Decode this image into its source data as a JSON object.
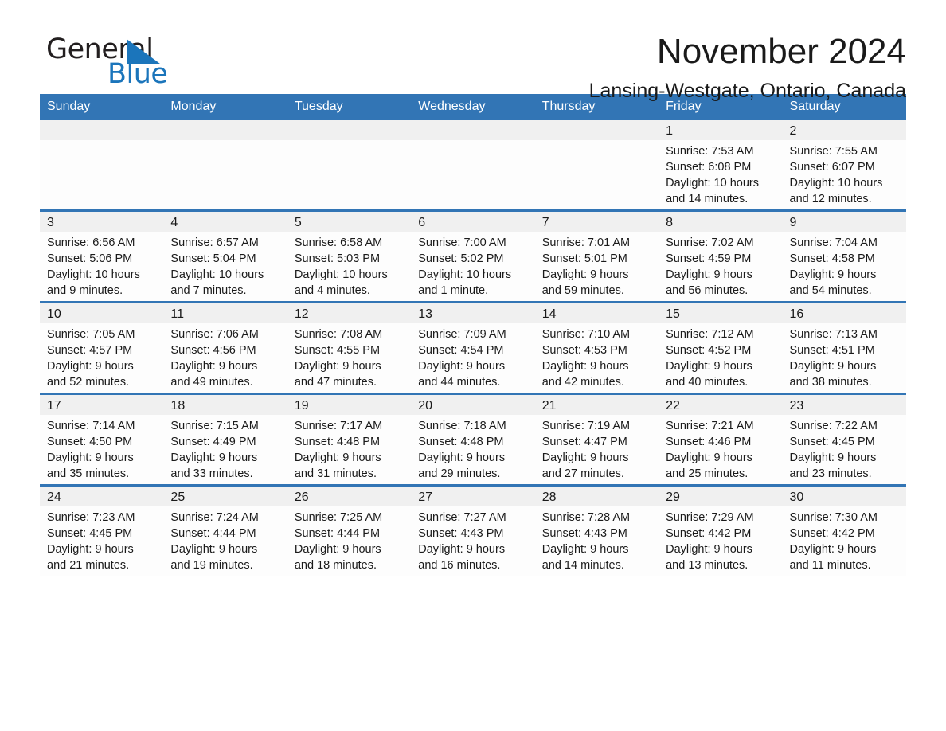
{
  "logo": {
    "word_1": "General",
    "word_2": "Blue",
    "triangle_color": "#1b75bb"
  },
  "header": {
    "title": "November 2024",
    "location": "Lansing-Westgate, Ontario, Canada",
    "accent_color": "#3275b5",
    "band_color": "#f0f0f0"
  },
  "weekday_headers": [
    "Sunday",
    "Monday",
    "Tuesday",
    "Wednesday",
    "Thursday",
    "Friday",
    "Saturday"
  ],
  "weeks": [
    [
      {
        "day": "",
        "empty": true
      },
      {
        "day": "",
        "empty": true
      },
      {
        "day": "",
        "empty": true
      },
      {
        "day": "",
        "empty": true
      },
      {
        "day": "",
        "empty": true
      },
      {
        "day": "1",
        "sunrise": "Sunrise: 7:53 AM",
        "sunset": "Sunset: 6:08 PM",
        "daylight_1": "Daylight: 10 hours",
        "daylight_2": "and 14 minutes."
      },
      {
        "day": "2",
        "sunrise": "Sunrise: 7:55 AM",
        "sunset": "Sunset: 6:07 PM",
        "daylight_1": "Daylight: 10 hours",
        "daylight_2": "and 12 minutes."
      }
    ],
    [
      {
        "day": "3",
        "sunrise": "Sunrise: 6:56 AM",
        "sunset": "Sunset: 5:06 PM",
        "daylight_1": "Daylight: 10 hours",
        "daylight_2": "and 9 minutes."
      },
      {
        "day": "4",
        "sunrise": "Sunrise: 6:57 AM",
        "sunset": "Sunset: 5:04 PM",
        "daylight_1": "Daylight: 10 hours",
        "daylight_2": "and 7 minutes."
      },
      {
        "day": "5",
        "sunrise": "Sunrise: 6:58 AM",
        "sunset": "Sunset: 5:03 PM",
        "daylight_1": "Daylight: 10 hours",
        "daylight_2": "and 4 minutes."
      },
      {
        "day": "6",
        "sunrise": "Sunrise: 7:00 AM",
        "sunset": "Sunset: 5:02 PM",
        "daylight_1": "Daylight: 10 hours",
        "daylight_2": "and 1 minute."
      },
      {
        "day": "7",
        "sunrise": "Sunrise: 7:01 AM",
        "sunset": "Sunset: 5:01 PM",
        "daylight_1": "Daylight: 9 hours",
        "daylight_2": "and 59 minutes."
      },
      {
        "day": "8",
        "sunrise": "Sunrise: 7:02 AM",
        "sunset": "Sunset: 4:59 PM",
        "daylight_1": "Daylight: 9 hours",
        "daylight_2": "and 56 minutes."
      },
      {
        "day": "9",
        "sunrise": "Sunrise: 7:04 AM",
        "sunset": "Sunset: 4:58 PM",
        "daylight_1": "Daylight: 9 hours",
        "daylight_2": "and 54 minutes."
      }
    ],
    [
      {
        "day": "10",
        "sunrise": "Sunrise: 7:05 AM",
        "sunset": "Sunset: 4:57 PM",
        "daylight_1": "Daylight: 9 hours",
        "daylight_2": "and 52 minutes."
      },
      {
        "day": "11",
        "sunrise": "Sunrise: 7:06 AM",
        "sunset": "Sunset: 4:56 PM",
        "daylight_1": "Daylight: 9 hours",
        "daylight_2": "and 49 minutes."
      },
      {
        "day": "12",
        "sunrise": "Sunrise: 7:08 AM",
        "sunset": "Sunset: 4:55 PM",
        "daylight_1": "Daylight: 9 hours",
        "daylight_2": "and 47 minutes."
      },
      {
        "day": "13",
        "sunrise": "Sunrise: 7:09 AM",
        "sunset": "Sunset: 4:54 PM",
        "daylight_1": "Daylight: 9 hours",
        "daylight_2": "and 44 minutes."
      },
      {
        "day": "14",
        "sunrise": "Sunrise: 7:10 AM",
        "sunset": "Sunset: 4:53 PM",
        "daylight_1": "Daylight: 9 hours",
        "daylight_2": "and 42 minutes."
      },
      {
        "day": "15",
        "sunrise": "Sunrise: 7:12 AM",
        "sunset": "Sunset: 4:52 PM",
        "daylight_1": "Daylight: 9 hours",
        "daylight_2": "and 40 minutes."
      },
      {
        "day": "16",
        "sunrise": "Sunrise: 7:13 AM",
        "sunset": "Sunset: 4:51 PM",
        "daylight_1": "Daylight: 9 hours",
        "daylight_2": "and 38 minutes."
      }
    ],
    [
      {
        "day": "17",
        "sunrise": "Sunrise: 7:14 AM",
        "sunset": "Sunset: 4:50 PM",
        "daylight_1": "Daylight: 9 hours",
        "daylight_2": "and 35 minutes."
      },
      {
        "day": "18",
        "sunrise": "Sunrise: 7:15 AM",
        "sunset": "Sunset: 4:49 PM",
        "daylight_1": "Daylight: 9 hours",
        "daylight_2": "and 33 minutes."
      },
      {
        "day": "19",
        "sunrise": "Sunrise: 7:17 AM",
        "sunset": "Sunset: 4:48 PM",
        "daylight_1": "Daylight: 9 hours",
        "daylight_2": "and 31 minutes."
      },
      {
        "day": "20",
        "sunrise": "Sunrise: 7:18 AM",
        "sunset": "Sunset: 4:48 PM",
        "daylight_1": "Daylight: 9 hours",
        "daylight_2": "and 29 minutes."
      },
      {
        "day": "21",
        "sunrise": "Sunrise: 7:19 AM",
        "sunset": "Sunset: 4:47 PM",
        "daylight_1": "Daylight: 9 hours",
        "daylight_2": "and 27 minutes."
      },
      {
        "day": "22",
        "sunrise": "Sunrise: 7:21 AM",
        "sunset": "Sunset: 4:46 PM",
        "daylight_1": "Daylight: 9 hours",
        "daylight_2": "and 25 minutes."
      },
      {
        "day": "23",
        "sunrise": "Sunrise: 7:22 AM",
        "sunset": "Sunset: 4:45 PM",
        "daylight_1": "Daylight: 9 hours",
        "daylight_2": "and 23 minutes."
      }
    ],
    [
      {
        "day": "24",
        "sunrise": "Sunrise: 7:23 AM",
        "sunset": "Sunset: 4:45 PM",
        "daylight_1": "Daylight: 9 hours",
        "daylight_2": "and 21 minutes."
      },
      {
        "day": "25",
        "sunrise": "Sunrise: 7:24 AM",
        "sunset": "Sunset: 4:44 PM",
        "daylight_1": "Daylight: 9 hours",
        "daylight_2": "and 19 minutes."
      },
      {
        "day": "26",
        "sunrise": "Sunrise: 7:25 AM",
        "sunset": "Sunset: 4:44 PM",
        "daylight_1": "Daylight: 9 hours",
        "daylight_2": "and 18 minutes."
      },
      {
        "day": "27",
        "sunrise": "Sunrise: 7:27 AM",
        "sunset": "Sunset: 4:43 PM",
        "daylight_1": "Daylight: 9 hours",
        "daylight_2": "and 16 minutes."
      },
      {
        "day": "28",
        "sunrise": "Sunrise: 7:28 AM",
        "sunset": "Sunset: 4:43 PM",
        "daylight_1": "Daylight: 9 hours",
        "daylight_2": "and 14 minutes."
      },
      {
        "day": "29",
        "sunrise": "Sunrise: 7:29 AM",
        "sunset": "Sunset: 4:42 PM",
        "daylight_1": "Daylight: 9 hours",
        "daylight_2": "and 13 minutes."
      },
      {
        "day": "30",
        "sunrise": "Sunrise: 7:30 AM",
        "sunset": "Sunset: 4:42 PM",
        "daylight_1": "Daylight: 9 hours",
        "daylight_2": "and 11 minutes."
      }
    ]
  ]
}
